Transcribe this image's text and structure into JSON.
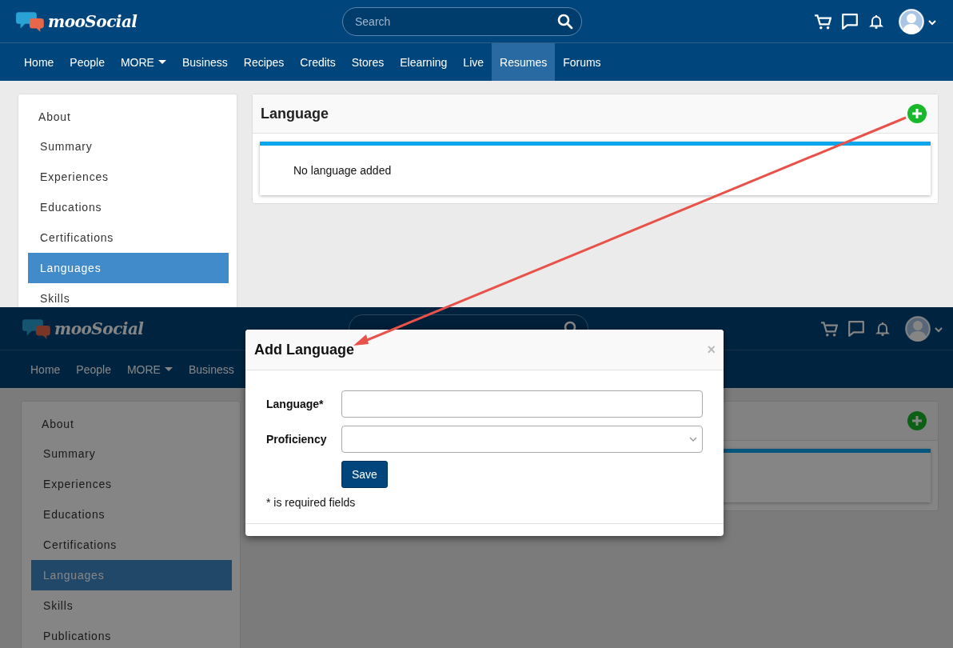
{
  "screens": [
    {
      "kind": "page",
      "logo": "mooSocial",
      "search": {
        "placeholder": "Search"
      },
      "nav": [
        {
          "label": "Home",
          "kind": "link",
          "selected": false
        },
        {
          "label": "People",
          "kind": "link",
          "selected": false
        },
        {
          "label": "MORE",
          "kind": "dropdown",
          "selected": false
        },
        {
          "label": "Business",
          "kind": "link",
          "selected": false
        },
        {
          "label": "Recipes",
          "kind": "link",
          "selected": false
        },
        {
          "label": "Credits",
          "kind": "link",
          "selected": false
        },
        {
          "label": "Stores",
          "kind": "link",
          "selected": false
        },
        {
          "label": "Elearning",
          "kind": "link",
          "selected": false
        },
        {
          "label": "Live",
          "kind": "link",
          "selected": false
        },
        {
          "label": "Resumes",
          "kind": "link",
          "selected": true
        },
        {
          "label": "Forums",
          "kind": "link",
          "selected": false
        }
      ],
      "sidebar": [
        {
          "label": "About",
          "selected": false
        },
        {
          "label": "Summary",
          "selected": false
        },
        {
          "label": "Experiences",
          "selected": false
        },
        {
          "label": "Educations",
          "selected": false
        },
        {
          "label": "Certifications",
          "selected": false
        },
        {
          "label": "Languages",
          "selected": true
        },
        {
          "label": "Skills",
          "selected": false
        }
      ],
      "panel": {
        "title": "Language",
        "message": "No language added"
      }
    },
    {
      "kind": "dialog",
      "logo": "mooSocial",
      "nav": [
        {
          "label": "Home",
          "kind": "link",
          "selected": false
        },
        {
          "label": "People",
          "kind": "link",
          "selected": false
        },
        {
          "label": "MORE",
          "kind": "dropdown",
          "selected": false
        },
        {
          "label": "Business",
          "kind": "link",
          "selected": false
        }
      ],
      "sidebar": [
        {
          "label": "About",
          "selected": false
        },
        {
          "label": "Summary",
          "selected": false
        },
        {
          "label": "Experiences",
          "selected": false
        },
        {
          "label": "Educations",
          "selected": false
        },
        {
          "label": "Certifications",
          "selected": false
        },
        {
          "label": "Languages",
          "selected": true
        },
        {
          "label": "Skills",
          "selected": false
        },
        {
          "label": "Publications",
          "selected": false
        }
      ],
      "dialog": {
        "title": "Add Language",
        "close": "×",
        "fields": [
          {
            "label": "Language*",
            "kind": "text"
          },
          {
            "label": "Proficiency",
            "kind": "select"
          }
        ],
        "button": "Save",
        "note": "* is required fields"
      }
    }
  ]
}
